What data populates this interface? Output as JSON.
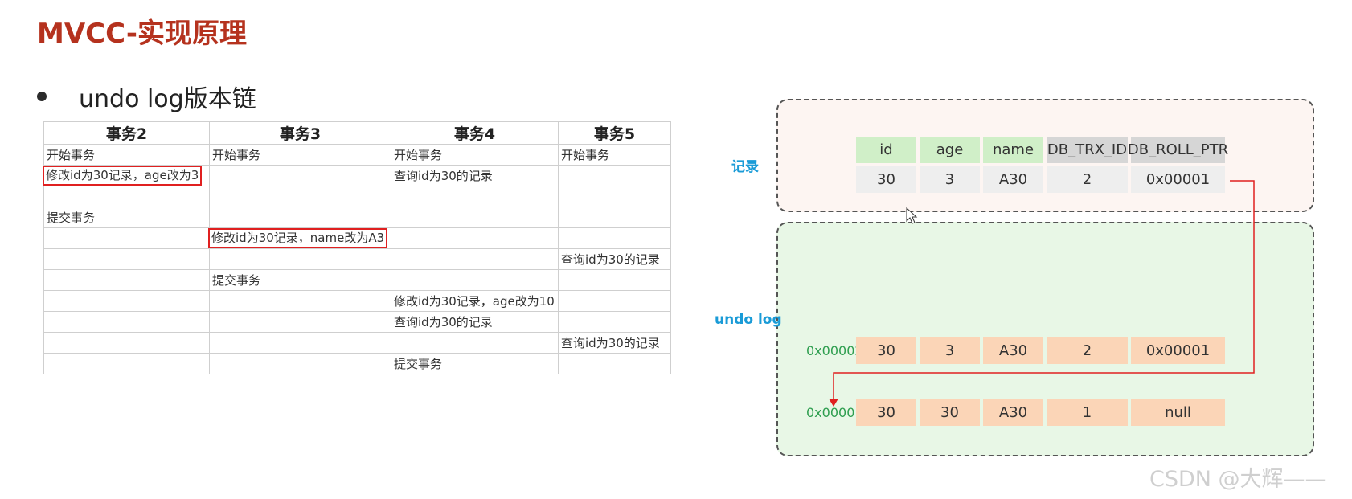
{
  "title": "MVCC-实现原理",
  "bullet": "undo log版本链",
  "table": {
    "headers": [
      "事务2",
      "事务3",
      "事务4",
      "事务5"
    ],
    "rows": [
      [
        "开始事务",
        "开始事务",
        "开始事务",
        "开始事务"
      ],
      [
        "修改id为30记录，age改为3",
        "",
        "查询id为30的记录",
        ""
      ],
      [
        "",
        "",
        "",
        ""
      ],
      [
        "提交事务",
        "",
        "",
        ""
      ],
      [
        "",
        "修改id为30记录，name改为A3",
        "",
        ""
      ],
      [
        "",
        "",
        "",
        "查询id为30的记录"
      ],
      [
        "",
        "提交事务",
        "",
        ""
      ],
      [
        "",
        "",
        "修改id为30记录，age改为10",
        ""
      ],
      [
        "",
        "",
        "查询id为30的记录",
        ""
      ],
      [
        "",
        "",
        "",
        "查询id为30的记录"
      ],
      [
        "",
        "",
        "提交事务",
        ""
      ]
    ]
  },
  "diagram": {
    "record_label": "记录",
    "undo_label": "undo log",
    "columns": [
      "id",
      "age",
      "name",
      "DB_TRX_ID",
      "DB_ROLL_PTR"
    ],
    "record": [
      "30",
      "3",
      "A30",
      "2",
      "0x00001"
    ],
    "undo_rows": [
      {
        "addr": "0x00002",
        "values": [
          "30",
          "3",
          "A30",
          "2",
          "0x00001"
        ]
      },
      {
        "addr": "0x00001",
        "values": [
          "30",
          "30",
          "A30",
          "1",
          "null"
        ]
      }
    ],
    "colors": {
      "header_green": "#d0efc8",
      "header_gray": "#d6d6d6",
      "undo_cell": "#fbd5b7",
      "arrow": "#e02020"
    }
  },
  "watermark": "CSDN @大辉——"
}
